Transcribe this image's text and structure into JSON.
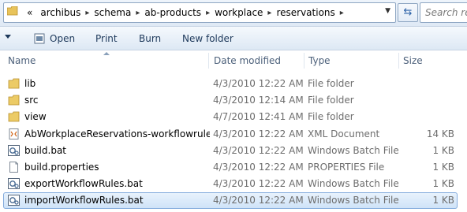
{
  "address": {
    "lead_glyph": "«",
    "crumbs": [
      "archibus",
      "schema",
      "ab-products",
      "workplace",
      "reservations"
    ],
    "search_placeholder": "Search re"
  },
  "toolbar": {
    "open_label": "Open",
    "print_label": "Print",
    "burn_label": "Burn",
    "new_folder_label": "New folder"
  },
  "columns": {
    "name": "Name",
    "date_modified": "Date modified",
    "type": "Type",
    "size": "Size"
  },
  "files": [
    {
      "icon": "folder-icon",
      "name": "lib",
      "date": "4/3/2010 12:22 AM",
      "type": "File folder",
      "size": ""
    },
    {
      "icon": "folder-icon",
      "name": "src",
      "date": "4/3/2010 12:14 AM",
      "type": "File folder",
      "size": ""
    },
    {
      "icon": "folder-icon",
      "name": "view",
      "date": "4/7/2010 12:41 AM",
      "type": "File folder",
      "size": ""
    },
    {
      "icon": "xml-file-icon",
      "name": "AbWorkplaceReservations-workflowrules...",
      "date": "4/3/2010 12:22 AM",
      "type": "XML Document",
      "size": "14 KB"
    },
    {
      "icon": "batch-file-icon",
      "name": "build.bat",
      "date": "4/3/2010 12:22 AM",
      "type": "Windows Batch File",
      "size": "1 KB"
    },
    {
      "icon": "generic-file-icon",
      "name": "build.properties",
      "date": "4/3/2010 12:22 AM",
      "type": "PROPERTIES File",
      "size": "1 KB"
    },
    {
      "icon": "batch-file-icon",
      "name": "exportWorkflowRules.bat",
      "date": "4/3/2010 12:22 AM",
      "type": "Windows Batch File",
      "size": "1 KB"
    },
    {
      "icon": "batch-file-icon",
      "name": "importWorkflowRules.bat",
      "date": "4/3/2010 12:22 AM",
      "type": "Windows Batch File",
      "size": "1 KB",
      "selected": true
    }
  ]
}
